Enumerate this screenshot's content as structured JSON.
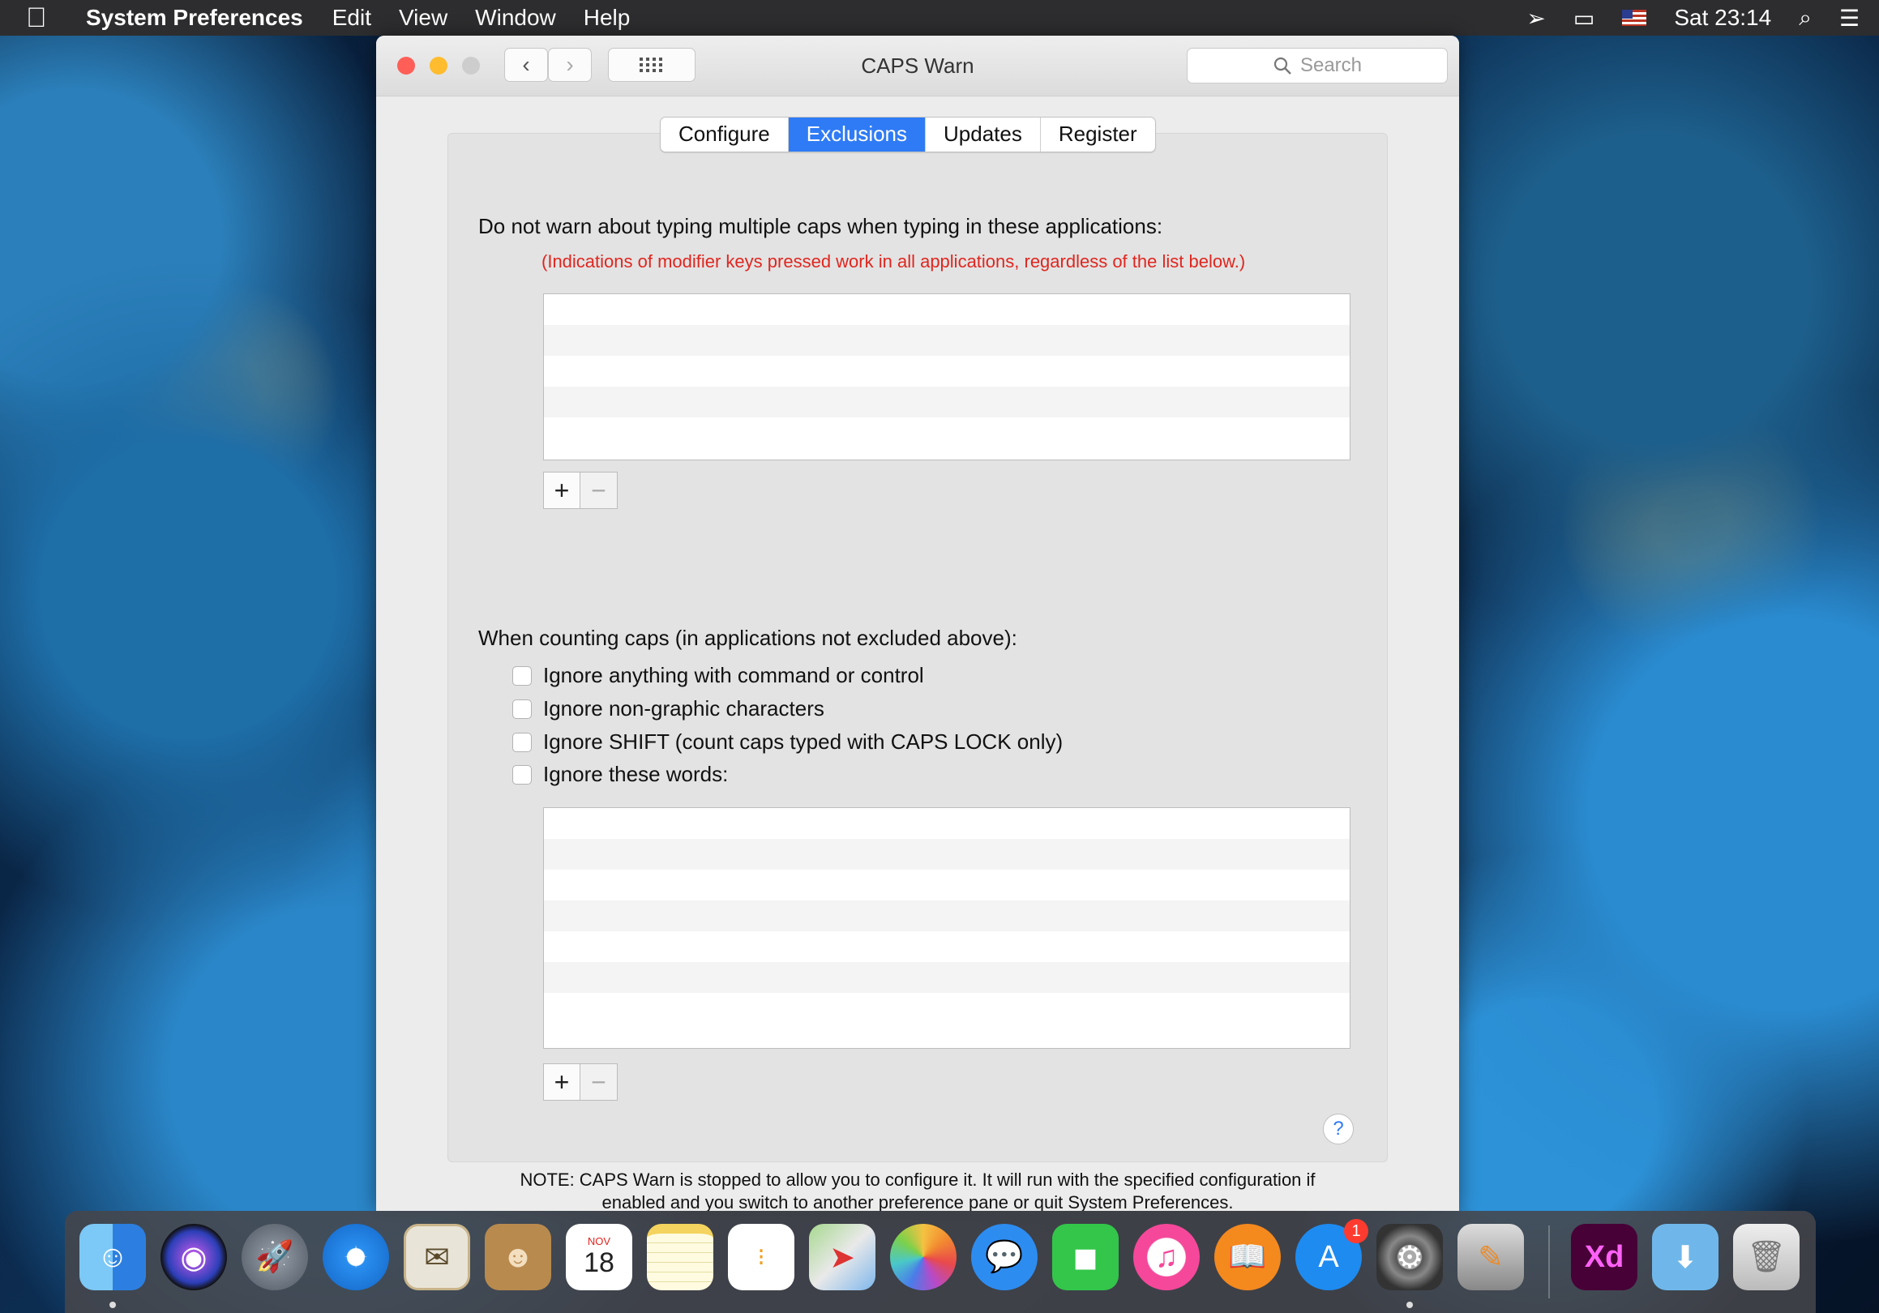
{
  "menubar": {
    "apple": "",
    "app_name": "System Preferences",
    "items": [
      "Edit",
      "View",
      "Window",
      "Help"
    ],
    "clock": "Sat 23:14"
  },
  "window": {
    "title": "CAPS Warn",
    "search_placeholder": "Search"
  },
  "tabs": [
    {
      "label": "Configure",
      "active": false
    },
    {
      "label": "Exclusions",
      "active": true
    },
    {
      "label": "Updates",
      "active": false
    },
    {
      "label": "Register",
      "active": false
    }
  ],
  "exclusions": {
    "app_heading": "Do not warn about typing multiple caps when typing in these applications:",
    "modifier_note": "(Indications of modifier keys pressed work in all applications, regardless of the list below.)",
    "add_label": "+",
    "remove_label": "−",
    "counting_heading": "When counting caps (in applications not excluded above):",
    "options": [
      {
        "label": "Ignore anything with command or control",
        "checked": false
      },
      {
        "label": "Ignore non-graphic characters",
        "checked": false
      },
      {
        "label": "Ignore SHIFT (count caps typed with CAPS LOCK only)",
        "checked": false
      },
      {
        "label": "Ignore these words:",
        "checked": false
      }
    ],
    "help_label": "?"
  },
  "footer": {
    "line1": "NOTE: CAPS Warn is stopped to allow you to configure it.  It will run with the specified configuration if",
    "line2": "enabled and you switch to another preference pane or quit System Preferences."
  },
  "dock": {
    "calendar_month": "NOV",
    "calendar_day": "18",
    "appstore_badge": "1",
    "xd_label": "Xd"
  },
  "colors": {
    "accent": "#2f7bf5",
    "warning_text": "#e0261f"
  }
}
